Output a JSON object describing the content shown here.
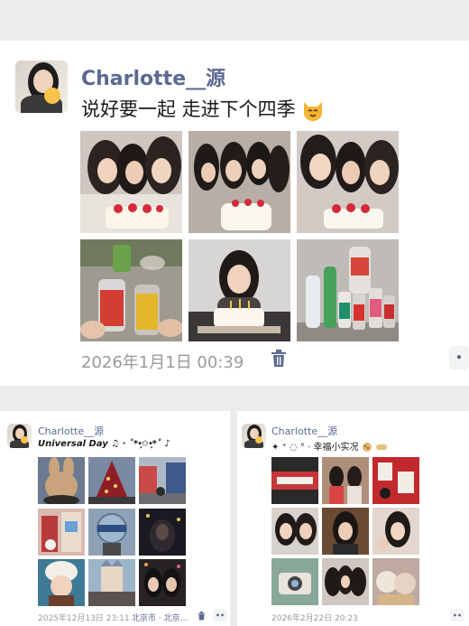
{
  "posts": [
    {
      "username": "Charlotte__源",
      "caption": "说好要一起  走进下个四季",
      "caption_emoji": "cat-face-emoji",
      "timestamp": "2026年1月1日 00:39",
      "photos": [
        "group-selfie-cake",
        "group-party",
        "group-selfie-cake-2",
        "drinks-toast",
        "girl-birthday-cake",
        "bottled-drinks"
      ]
    },
    {
      "username": "Charlotte__源",
      "caption": "Universal Day ♫ · ˚*•̩̩͙✩•̩̩͙*˚ ♪",
      "timestamp": "2025年12月13日 23:11",
      "location": "北京市 · 北京…",
      "photos": [
        "plush-toy",
        "christmas-tree",
        "park-street",
        "storefront",
        "universal-globe",
        "night-ride",
        "plush-hat",
        "castle-crowd",
        "night-friends"
      ]
    },
    {
      "username": "Charlotte__源",
      "caption": "✦ ⁺ ◌ ° · 幸福小实况",
      "caption_emoji": "cookie-emoji",
      "timestamp": "2026年2月22日 20:23",
      "photos": [
        "red-banner",
        "group-indoor",
        "red-lanterns",
        "two-girls-selfie",
        "girl-portrait",
        "friend-selfie",
        "camera-table",
        "three-friends",
        "plush-dolls"
      ]
    }
  ],
  "more_button": "••",
  "colors": {
    "username": "#5b6a92",
    "timestamp": "#9a9a9a",
    "card": "#ffffff",
    "background": "#ececec"
  }
}
